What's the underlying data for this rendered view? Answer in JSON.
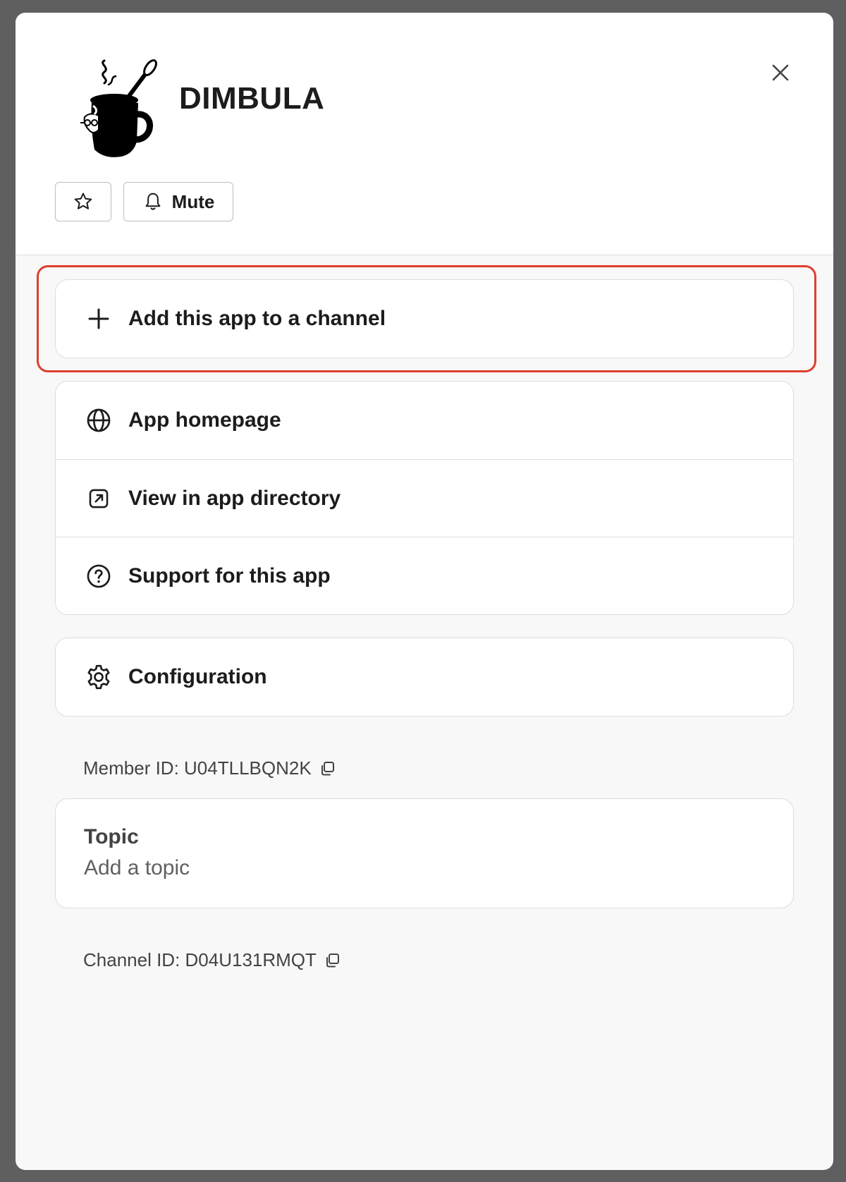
{
  "app": {
    "name": "DIMBULA",
    "logo_icon": "coffee-mug-logo-icon"
  },
  "header": {
    "close_icon": "close-icon",
    "star_icon": "star-icon",
    "mute_icon": "bell-icon",
    "mute_label": "Mute"
  },
  "actions": {
    "add_to_channel": {
      "icon": "plus-icon",
      "label": "Add this app to a channel"
    },
    "links": [
      {
        "icon": "globe-icon",
        "label": "App homepage"
      },
      {
        "icon": "external-link-icon",
        "label": "View in app directory"
      },
      {
        "icon": "question-circle-icon",
        "label": "Support for this app"
      }
    ],
    "configuration": {
      "icon": "gear-icon",
      "label": "Configuration"
    }
  },
  "member": {
    "label": "Member ID: U04TLLBQN2K",
    "copy_icon": "copy-icon"
  },
  "topic": {
    "title": "Topic",
    "value": "Add a topic"
  },
  "channel": {
    "label": "Channel ID: D04U131RMQT",
    "copy_icon": "copy-icon"
  },
  "colors": {
    "highlight": "#e03e2d",
    "text": "#1d1c1d",
    "muted_text": "#454245",
    "border": "#dddddd"
  }
}
